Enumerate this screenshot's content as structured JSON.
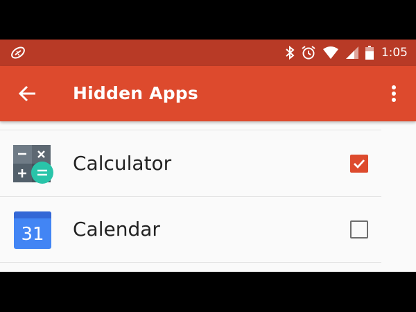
{
  "status_bar": {
    "time": "1:05",
    "icons": [
      "tracking-icon",
      "bluetooth-icon",
      "alarm-icon",
      "wifi-icon",
      "signal-icon",
      "battery-icon"
    ]
  },
  "app_bar": {
    "title": "Hidden Apps",
    "back_icon": "arrow-back-icon",
    "menu_icon": "more-vert-icon"
  },
  "apps": [
    {
      "name": "Calculator",
      "icon": "calculator-icon",
      "checked": true
    },
    {
      "name": "Calendar",
      "icon": "calendar-icon",
      "icon_text": "31",
      "checked": false
    }
  ],
  "colors": {
    "status_bar": "#b83a26",
    "app_bar": "#dd4a2d",
    "accent": "#dd4a2d",
    "background": "#fafafa"
  }
}
